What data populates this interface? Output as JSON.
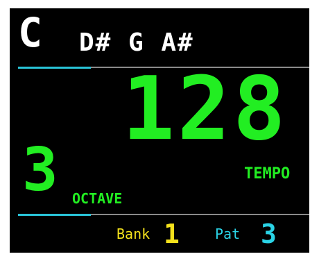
{
  "colors": {
    "background": "#000000",
    "root_note": "#ffffff",
    "chord_notes": "#ffffff",
    "tempo": "#22ee22",
    "octave": "#22ee22",
    "bank": "#f5e21c",
    "pattern": "#2ad3e6",
    "divider": "#8a8a8a",
    "divider_accent": "#29c4d8"
  },
  "chord": {
    "root": "C",
    "notes": "D# G A#"
  },
  "tempo": {
    "value": "128",
    "label": "TEMPO"
  },
  "octave": {
    "value": "3",
    "label": "OCTAVE"
  },
  "bank": {
    "label": "Bank",
    "value": "1"
  },
  "pattern": {
    "label": "Pat",
    "value": "3"
  },
  "dividers": {
    "accent_fraction": 0.25
  }
}
